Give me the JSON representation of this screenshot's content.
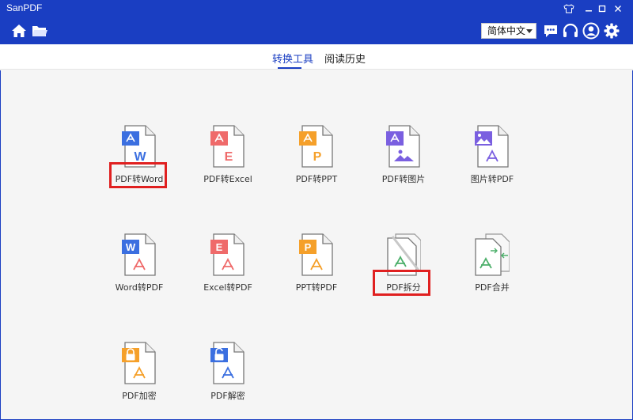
{
  "app": {
    "title": "SanPDF"
  },
  "toolbar": {
    "language": "简体中文"
  },
  "tabs": [
    {
      "label": "转换工具",
      "active": true
    },
    {
      "label": "阅读历史",
      "active": false
    }
  ],
  "tools": [
    {
      "label": "PDF转Word",
      "icon": "pdf-to-word-icon",
      "color": "#3b6fe0",
      "letter": "W",
      "highlighted": true
    },
    {
      "label": "PDF转Excel",
      "icon": "pdf-to-excel-icon",
      "color": "#ef6a6a",
      "letter": "E",
      "highlighted": false
    },
    {
      "label": "PDF转PPT",
      "icon": "pdf-to-ppt-icon",
      "color": "#f5a02a",
      "letter": "P",
      "highlighted": false
    },
    {
      "label": "PDF转图片",
      "icon": "pdf-to-image-icon",
      "color": "#7a5fe0",
      "letter": "",
      "highlighted": false
    },
    {
      "label": "图片转PDF",
      "icon": "image-to-pdf-icon",
      "color": "#7a5fe0",
      "letter": "",
      "highlighted": false
    },
    {
      "label": "Word转PDF",
      "icon": "word-to-pdf-icon",
      "color": "#3b6fe0",
      "letter": "W",
      "highlighted": false
    },
    {
      "label": "Excel转PDF",
      "icon": "excel-to-pdf-icon",
      "color": "#ef6a6a",
      "letter": "E",
      "highlighted": false
    },
    {
      "label": "PPT转PDF",
      "icon": "ppt-to-pdf-icon",
      "color": "#f5a02a",
      "letter": "P",
      "highlighted": false
    },
    {
      "label": "PDF拆分",
      "icon": "pdf-split-icon",
      "color": "#4caf6a",
      "letter": "",
      "highlighted": true
    },
    {
      "label": "PDF合并",
      "icon": "pdf-merge-icon",
      "color": "#4caf6a",
      "letter": "",
      "highlighted": false
    },
    {
      "label": "PDF加密",
      "icon": "pdf-encrypt-icon",
      "color": "#f5a02a",
      "letter": "",
      "highlighted": false
    },
    {
      "label": "PDF解密",
      "icon": "pdf-decrypt-icon",
      "color": "#3b6fe0",
      "letter": "",
      "highlighted": false
    }
  ]
}
